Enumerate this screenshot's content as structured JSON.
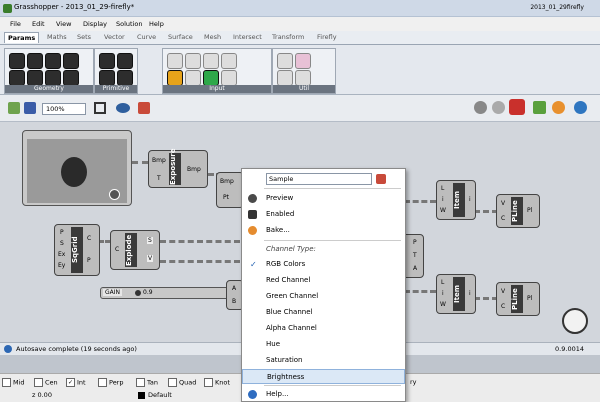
{
  "window": {
    "title": "Grasshopper - 2013_01_29-firefly*",
    "doc_name": "2013_01_29firefly"
  },
  "menubar": [
    "File",
    "Edit",
    "View",
    "Display",
    "Solution",
    "Help"
  ],
  "tabs": [
    "Params",
    "Maths",
    "Sets",
    "Vector",
    "Curve",
    "Surface",
    "Mesh",
    "Intersect",
    "Transform",
    "Firefly"
  ],
  "ribbon_groups": [
    "Geometry",
    "Primitive",
    "Input",
    "Util"
  ],
  "toolbar": {
    "zoom": "100%"
  },
  "components": {
    "exposure": {
      "name": "Exposure",
      "inputs": [
        "Bmp",
        "T"
      ],
      "outputs": [
        "Bmp"
      ]
    },
    "sqgrid": {
      "name": "SqGrid",
      "inputs": [
        "P",
        "S",
        "Ex",
        "Ey"
      ],
      "outputs": [
        "C",
        "P"
      ]
    },
    "explode": {
      "name": "Explode",
      "inputs": [
        "C"
      ],
      "outputs": [
        "S",
        "V"
      ]
    },
    "item1": {
      "name": "Item",
      "inputs": [
        "L",
        "i",
        "W"
      ],
      "outputs": [
        "i"
      ]
    },
    "item2": {
      "name": "Item",
      "inputs": [
        "L",
        "i",
        "W"
      ],
      "outputs": [
        "i"
      ]
    },
    "pline1": {
      "name": "PLine",
      "inputs": [
        "V",
        "C"
      ],
      "outputs": [
        "Pl"
      ]
    },
    "pline2": {
      "name": "PLine",
      "inputs": [
        "V",
        "C"
      ],
      "outputs": [
        "Pl"
      ]
    },
    "partial": {
      "inputs": [
        "Bmp",
        "Pt"
      ]
    },
    "partial2": {
      "inputs": [
        "A",
        "B"
      ]
    },
    "partial3": {
      "inputs": [
        "P",
        "T",
        "A"
      ]
    },
    "gain": {
      "label": "GAIN",
      "value": "0.9"
    }
  },
  "status": {
    "message": "Autosave complete (19 seconds ago)",
    "version": "0.9.0014"
  },
  "snaps": [
    "Mid",
    "Cen",
    "Int",
    "Perp",
    "Tan",
    "Quad",
    "Knot",
    "ry"
  ],
  "coords": {
    "z": "z 0.00",
    "layer": "Default"
  },
  "context_menu": {
    "name_field": "Sample",
    "items_top": [
      "Preview",
      "Enabled",
      "Bake..."
    ],
    "section_label": "Channel Type:",
    "channels": [
      "RGB Colors",
      "Red Channel",
      "Green Channel",
      "Blue Channel",
      "Alpha Channel",
      "Hue",
      "Saturation",
      "Brightness"
    ],
    "checked": "RGB Colors",
    "highlighted": "Brightness",
    "help": "Help..."
  }
}
